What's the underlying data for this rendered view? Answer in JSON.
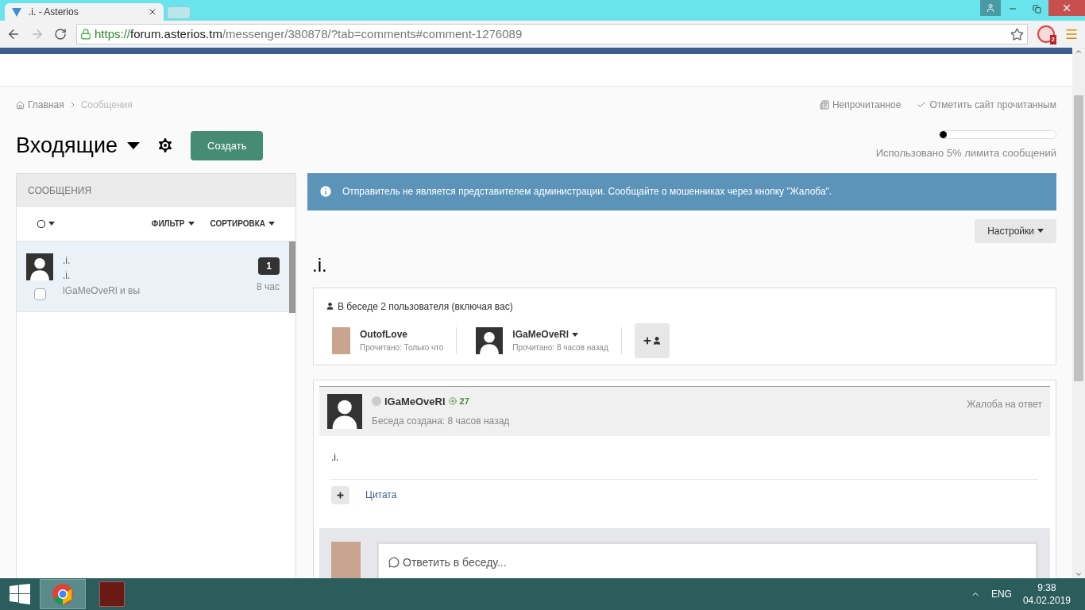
{
  "browser": {
    "tabs": [
      {
        "title": ".i. - Asterios",
        "selected": true
      }
    ],
    "url": {
      "scheme": "https://",
      "host": "forum.asterios.tm",
      "path": "/messenger/380878/?tab=comments#comment-1276089"
    },
    "extension_badge": "2"
  },
  "breadcrumb": [
    "Главная",
    "Сообщения"
  ],
  "top_links": [
    {
      "kind": "unread",
      "label": "Непрочитанное"
    },
    {
      "kind": "mark",
      "label": "Отметить сайт прочитанным"
    }
  ],
  "inbox": {
    "title": "Входящие",
    "create_button": "Создать"
  },
  "quota": {
    "level": 0.05,
    "text": "Использовано 5% лимита сообщений"
  },
  "sidebar": {
    "header": "СООБЩЕНИЯ",
    "filter": "ФИЛЬТР",
    "sort": "СОРТИРОВКА",
    "select_all_checked": false,
    "conversations": [
      {
        "title": ".i.",
        "preview": ".i.",
        "participants": "lGaMeOveRl и вы",
        "unread": "1",
        "time": "8 час",
        "selected": true,
        "checked": false
      }
    ]
  },
  "notice": "Отправитель не является представителем администрации. Сообщайте о мошенниках через кнопку \"Жалоба\".",
  "settings_button": "Настройки",
  "conversation": {
    "title": ".i.",
    "participants_header": "В беседе 2 пользователя (включая вас)",
    "participants": [
      {
        "name": "OutofLove",
        "read": "Прочитано: Только что",
        "kind": "photo",
        "menu": false
      },
      {
        "name": "lGaMeOveRl",
        "read": "Прочитано: 8 часов назад",
        "kind": "silhouette",
        "menu": true
      }
    ],
    "post": {
      "author": "lGaMeOveRl",
      "online": false,
      "reputation": "27",
      "meta": "Беседа создана: 8 часов назад",
      "report": "Жалоба на ответ",
      "body": ".i.",
      "quote": "Цитата"
    },
    "reply_placeholder": "Ответить в беседу..."
  },
  "taskbar": {
    "language": "ENG",
    "time": "9:38",
    "date": "04.02.2019"
  }
}
